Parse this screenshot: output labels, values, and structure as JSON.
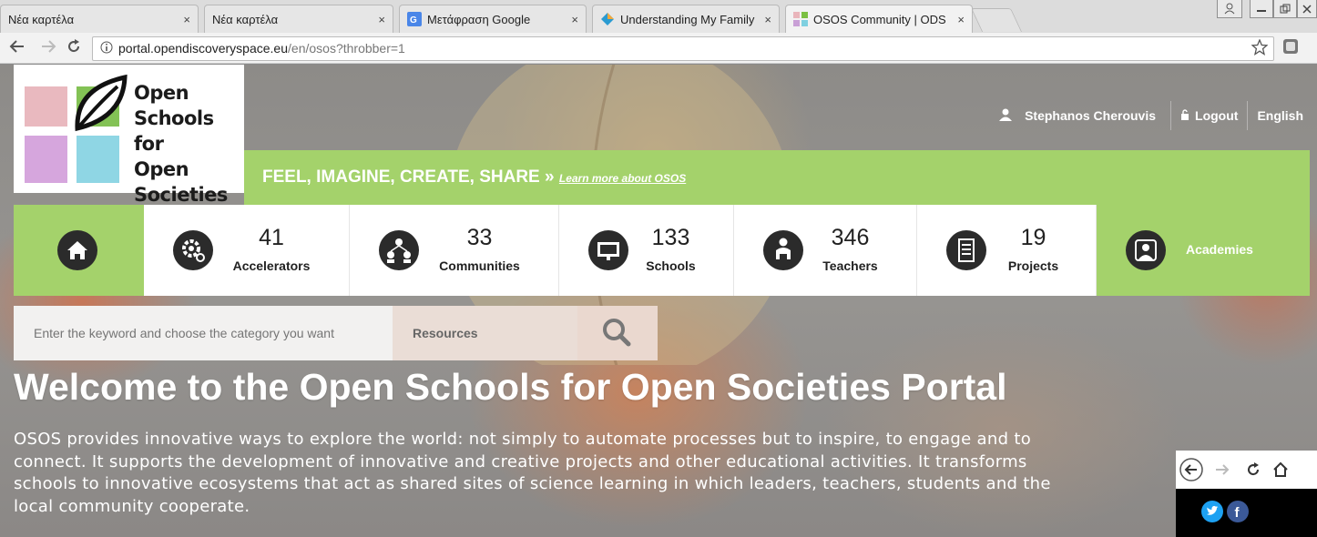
{
  "browser": {
    "tabs": [
      {
        "title": "Νέα καρτέλα",
        "close": "×"
      },
      {
        "title": "Νέα καρτέλα",
        "close": "×"
      },
      {
        "title": "Μετάφραση Google",
        "close": "×"
      },
      {
        "title": "Understanding My Family",
        "close": "×"
      },
      {
        "title": "OSOS Community | ODS",
        "close": "×"
      }
    ],
    "url_host": "portal.opendiscoveryspace.eu",
    "url_path": "/en/osos?throbber=1"
  },
  "logo": {
    "line1": "Open",
    "line2": "Schools for",
    "line3": "Open",
    "line4": "Societies"
  },
  "user": {
    "name": "Stephanos Cherouvis",
    "logout": "Logout",
    "language": "English"
  },
  "tagline": {
    "text": "FEEL, IMAGINE, CREATE, SHARE »",
    "link": "Learn more about OSOS"
  },
  "stats": [
    {
      "number": "41",
      "label": "Accelerators",
      "icon": "accelerators-gear-icon"
    },
    {
      "number": "33",
      "label": "Communities",
      "icon": "communities-people-icon"
    },
    {
      "number": "133",
      "label": "Schools",
      "icon": "schools-board-icon"
    },
    {
      "number": "346",
      "label": "Teachers",
      "icon": "teacher-icon"
    },
    {
      "number": "19",
      "label": "Projects",
      "icon": "projects-list-icon"
    }
  ],
  "academies_label": "Academies",
  "search": {
    "placeholder": "Enter the keyword and choose the category you want",
    "category": "Resources"
  },
  "welcome_title": "Welcome to the Open Schools for Open Societies Portal",
  "intro": "OSOS provides innovative ways to explore the world: not simply to automate processes but to inspire, to engage and to connect. It supports the development of innovative and creative projects and other educational activities. It transforms schools to innovative ecosystems that act as shared sites of science learning in which leaders, teachers, students and the local community cooperate.",
  "colors": {
    "brand_green": "#a4d26b",
    "icon_dark": "#2b2b2b",
    "twitter": "#1da1f2",
    "facebook": "#3b5998"
  }
}
